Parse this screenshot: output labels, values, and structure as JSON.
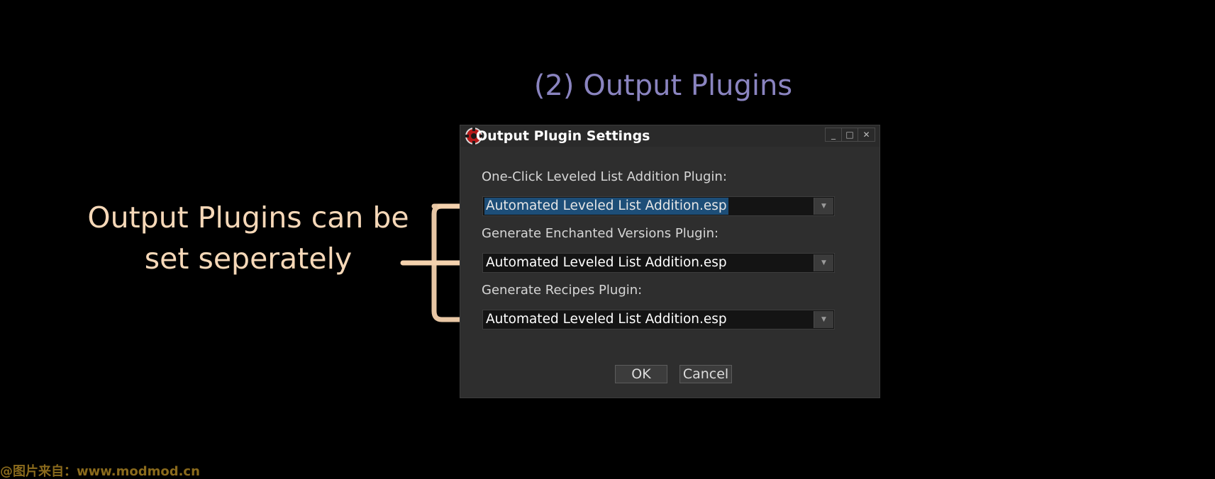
{
  "slide": {
    "heading": "(2) Output Plugins",
    "annotation_line1": "Output Plugins can be",
    "annotation_line2": "set seperately"
  },
  "dialog": {
    "title": "Output Plugin Settings",
    "window_controls": {
      "minimize": "_",
      "maximize": "□",
      "close": "✕"
    },
    "fields": [
      {
        "label": "One-Click Leveled List Addition Plugin:",
        "value": "Automated Leveled List Addition.esp",
        "selected": true
      },
      {
        "label": "Generate Enchanted Versions Plugin:",
        "value": "Automated Leveled List Addition.esp",
        "selected": false
      },
      {
        "label": "Generate Recipes Plugin:",
        "value": "Automated Leveled List Addition.esp",
        "selected": false
      }
    ],
    "dropdown_arrow": "▼",
    "ok_label": "OK",
    "cancel_label": "Cancel",
    "icons": {
      "app": "gear-app-icon",
      "dropdown": "chevron-down-icon"
    }
  },
  "watermark": "@图片来自：www.modmod.cn",
  "colors": {
    "background": "#000000",
    "heading": "#8a84c0",
    "annotation": "#f6d8b8",
    "bracket": "#f4d2ae",
    "dialog_bg": "#2e2e2e",
    "selection": "#1d4e78",
    "watermark": "#8a6a1c"
  }
}
